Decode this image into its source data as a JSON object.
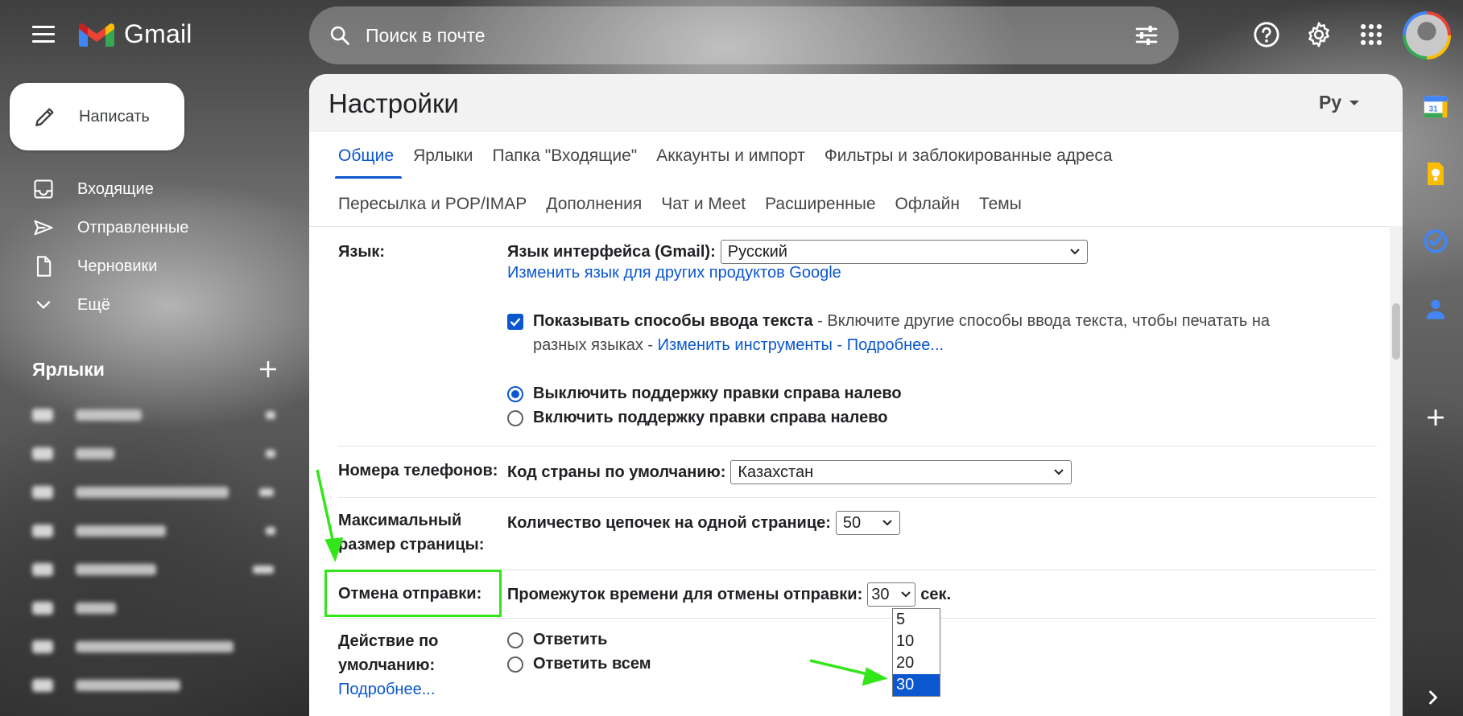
{
  "app": {
    "name": "Gmail",
    "search_placeholder": "Поиск в почте"
  },
  "sidebar": {
    "compose_label": "Написать",
    "nav": [
      {
        "label": "Входящие",
        "icon": "inbox-icon"
      },
      {
        "label": "Отправленные",
        "icon": "send-icon"
      },
      {
        "label": "Черновики",
        "icon": "draft-icon"
      },
      {
        "label": "Ещё",
        "icon": "chevron-down-icon"
      }
    ],
    "labels_title": "Ярлыки"
  },
  "settings": {
    "title": "Настройки",
    "lang_switch": "Ру",
    "tabs_row1": [
      "Общие",
      "Ярлыки",
      "Папка \"Входящие\"",
      "Аккаунты и импорт",
      "Фильтры и заблокированные адреса"
    ],
    "tabs_row2": [
      "Пересылка и POP/IMAP",
      "Дополнения",
      "Чат и Meet",
      "Расширенные",
      "Офлайн",
      "Темы"
    ],
    "language": {
      "label": "Язык:",
      "interface_label": "Язык интерфейса (Gmail):",
      "interface_value": "Русский",
      "change_link": "Изменить язык для других продуктов Google",
      "input_tools_bold": "Показывать способы ввода текста",
      "input_tools_text": " - Включите другие способы ввода текста, чтобы печатать на",
      "input_tools_text2": "разных языках - ",
      "input_tools_link": "Изменить инструменты",
      "dash": " - ",
      "more_link": "Подробнее...",
      "rtl_off": "Выключить поддержку правки справа налево",
      "rtl_on": "Включить поддержку правки справа налево"
    },
    "phone": {
      "label": "Номера телефонов:",
      "country_label": "Код страны по умолчанию:",
      "country_value": "Казахстан"
    },
    "page_size": {
      "label_line1": "Максимальный",
      "label_line2": "размер страницы:",
      "threads_label": "Количество цепочек на одной странице:",
      "threads_value": "50"
    },
    "undo_send": {
      "label": "Отмена отправки:",
      "period_label": "Промежуток времени для отмены отправки:",
      "period_value": "30",
      "unit": "сек.",
      "options": [
        "5",
        "10",
        "20",
        "30"
      ]
    },
    "reply": {
      "label_line1": "Действие по",
      "label_line2": "умолчанию:",
      "more_link": "Подробнее...",
      "reply": "Ответить",
      "reply_all": "Ответить всем"
    }
  },
  "colors": {
    "accent": "#0b57d0",
    "highlight": "#33e61a"
  }
}
